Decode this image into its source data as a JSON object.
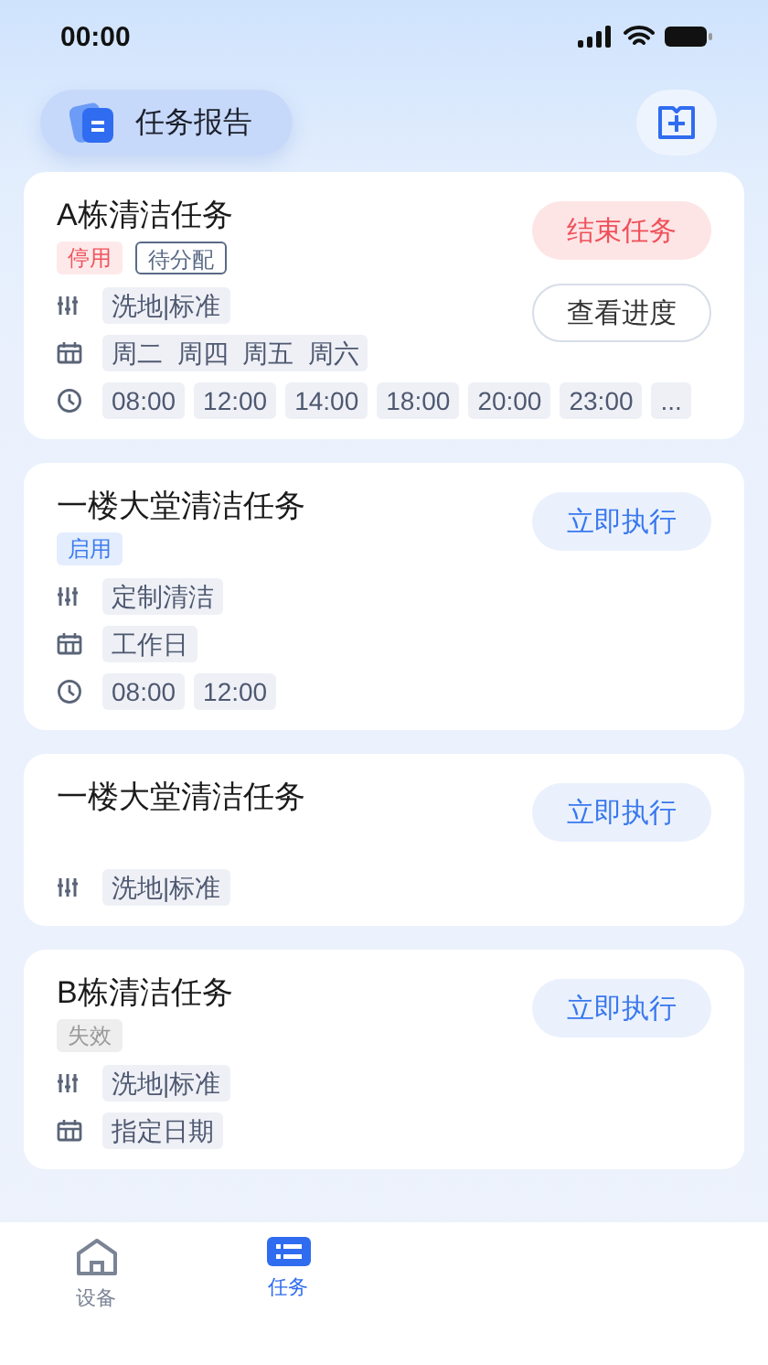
{
  "status_bar": {
    "time": "00:00"
  },
  "header": {
    "title": "任务报告"
  },
  "tasks": [
    {
      "title": "A栋清洁任务",
      "badges": [
        {
          "text": "停用",
          "kind": "disabled"
        },
        {
          "text": "待分配",
          "kind": "outline"
        }
      ],
      "buttons": [
        {
          "text": "结束任务",
          "kind": "danger"
        },
        {
          "text": "查看进度",
          "kind": "outline"
        }
      ],
      "rows": [
        {
          "kind": "mode",
          "chips": [
            "洗地|标准"
          ]
        },
        {
          "kind": "days",
          "chips": [
            "周二  周四  周五  周六"
          ]
        },
        {
          "kind": "times",
          "chips": [
            "08:00",
            "12:00",
            "14:00",
            "18:00",
            "20:00",
            "23:00",
            "..."
          ]
        }
      ]
    },
    {
      "title": "一楼大堂清洁任务",
      "badges": [
        {
          "text": "启用",
          "kind": "enabled"
        }
      ],
      "buttons": [
        {
          "text": "立即执行",
          "kind": "primary"
        }
      ],
      "rows": [
        {
          "kind": "mode",
          "chips": [
            "定制清洁"
          ]
        },
        {
          "kind": "days",
          "chips": [
            "工作日"
          ]
        },
        {
          "kind": "times",
          "chips": [
            "08:00",
            "12:00"
          ]
        }
      ]
    },
    {
      "title": "一楼大堂清洁任务",
      "buttons": [
        {
          "text": "立即执行",
          "kind": "primary"
        }
      ],
      "rows": [
        {
          "kind": "mode",
          "chips": [
            "洗地|标准"
          ]
        }
      ]
    },
    {
      "title": "B栋清洁任务",
      "badges": [
        {
          "text": "失效",
          "kind": "invalid"
        }
      ],
      "buttons": [
        {
          "text": "立即执行",
          "kind": "primary"
        }
      ],
      "rows": [
        {
          "kind": "mode",
          "chips": [
            "洗地|标准"
          ]
        },
        {
          "kind": "days",
          "chips": [
            "指定日期"
          ]
        }
      ]
    }
  ],
  "tab_bar": [
    {
      "label": "设备",
      "selected": false
    },
    {
      "label": "任务",
      "selected": true
    }
  ]
}
